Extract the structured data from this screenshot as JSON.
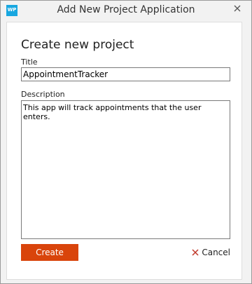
{
  "window": {
    "title": "Add New Project Application",
    "app_icon_text": "WP",
    "app_icon_color": "#18a7e0"
  },
  "form": {
    "heading": "Create new project",
    "title_label": "Title",
    "title_value": "AppointmentTracker",
    "description_label": "Description",
    "description_value": "This app will track appointments that the user enters."
  },
  "actions": {
    "create_label": "Create",
    "create_color": "#d9440b",
    "cancel_label": "Cancel",
    "cancel_icon_color": "#c0392b"
  },
  "icons": {
    "app": "app-logo-icon",
    "close": "close-icon",
    "cancel": "cancel-x-icon"
  }
}
